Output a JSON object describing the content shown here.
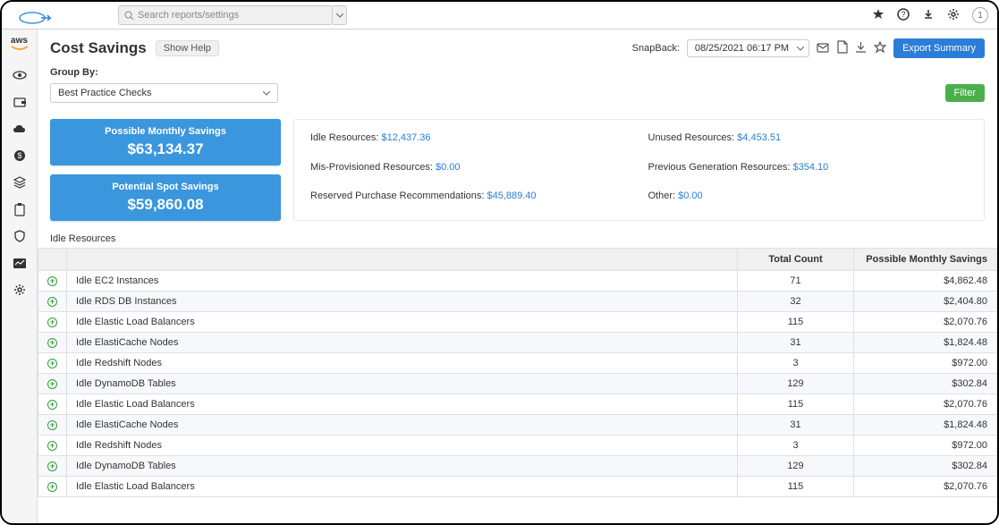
{
  "topbar": {
    "search_placeholder": "Search reports/settings",
    "user_badge": "1"
  },
  "sidebar": {
    "aws_label": "aws"
  },
  "header": {
    "title": "Cost Savings",
    "show_help": "Show Help",
    "snapback_label": "SnapBack:",
    "snapback_date": "08/25/2021 06:17 PM",
    "export_label": "Export Summary"
  },
  "groupby": {
    "label": "Group By:",
    "selected": "Best Practice Checks",
    "filter_label": "Filter"
  },
  "savings_cards": [
    {
      "title": "Possible Monthly Savings",
      "amount": "$63,134.37"
    },
    {
      "title": "Potential Spot Savings",
      "amount": "$59,860.08"
    }
  ],
  "metrics": [
    {
      "label": "Idle Resources:",
      "value": "$12,437.36"
    },
    {
      "label": "Unused Resources:",
      "value": "$4,453.51"
    },
    {
      "label": "Mis-Provisioned Resources:",
      "value": "$0.00"
    },
    {
      "label": "Previous Generation Resources:",
      "value": "$354.10"
    },
    {
      "label": "Reserved Purchase Recommendations:",
      "value": "$45,889.40"
    },
    {
      "label": "Other:",
      "value": "$0.00"
    }
  ],
  "table": {
    "section_title": "Idle Resources",
    "headers": {
      "name": "",
      "count": "Total Count",
      "savings": "Possible Monthly Savings"
    },
    "rows": [
      {
        "name": "Idle EC2 Instances",
        "count": "71",
        "savings": "$4,862.48"
      },
      {
        "name": "Idle RDS DB Instances",
        "count": "32",
        "savings": "$2,404.80"
      },
      {
        "name": "Idle Elastic Load Balancers",
        "count": "115",
        "savings": "$2,070.76"
      },
      {
        "name": "Idle ElastiCache Nodes",
        "count": "31",
        "savings": "$1,824.48"
      },
      {
        "name": "Idle Redshift Nodes",
        "count": "3",
        "savings": "$972.00"
      },
      {
        "name": "Idle DynamoDB Tables",
        "count": "129",
        "savings": "$302.84"
      },
      {
        "name": "Idle Elastic Load Balancers",
        "count": "115",
        "savings": "$2,070.76"
      },
      {
        "name": "Idle ElastiCache Nodes",
        "count": "31",
        "savings": "$1,824.48"
      },
      {
        "name": "Idle Redshift Nodes",
        "count": "3",
        "savings": "$972.00"
      },
      {
        "name": "Idle DynamoDB Tables",
        "count": "129",
        "savings": "$302.84"
      },
      {
        "name": "Idle Elastic Load Balancers",
        "count": "115",
        "savings": "$2,070.76"
      }
    ]
  }
}
